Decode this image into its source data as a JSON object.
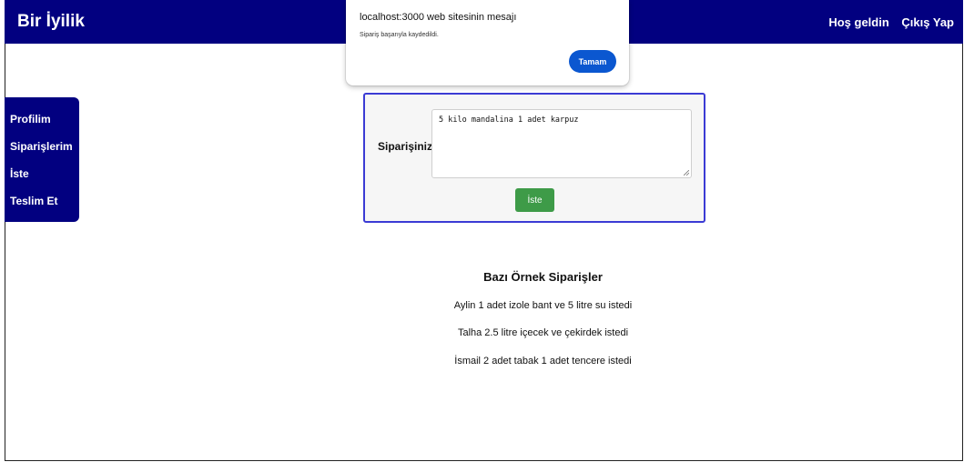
{
  "navbar": {
    "brand": "Bir İyilik",
    "welcome": "Hoş geldin",
    "logout": "Çıkış Yap"
  },
  "sidebar": {
    "items": [
      {
        "label": "Profilim"
      },
      {
        "label": "Siparişlerim"
      },
      {
        "label": "İste"
      },
      {
        "label": "Teslim Et"
      }
    ]
  },
  "dialog": {
    "title": "localhost:3000 web sitesinin mesajı",
    "message": "Sipariş başarıyla kaydedildi.",
    "ok_label": "Tamam"
  },
  "order_form": {
    "label": "Siparişiniz:",
    "value": "5 kilo mandalina 1 adet karpuz",
    "submit_label": "İste"
  },
  "examples": {
    "title": "Bazı Örnek Siparişler",
    "items": [
      "Aylin 1 adet izole bant ve 5 litre su istedi",
      "Talha 2.5 litre içecek ve çekirdek istedi",
      "İsmail 2 adet tabak 1 adet tencere istedi"
    ]
  },
  "colors": {
    "navbar_bg": "#020080",
    "form_border": "#3b3bd4",
    "submit_bg": "#3e9b48",
    "dialog_button_bg": "#0b57d0"
  }
}
